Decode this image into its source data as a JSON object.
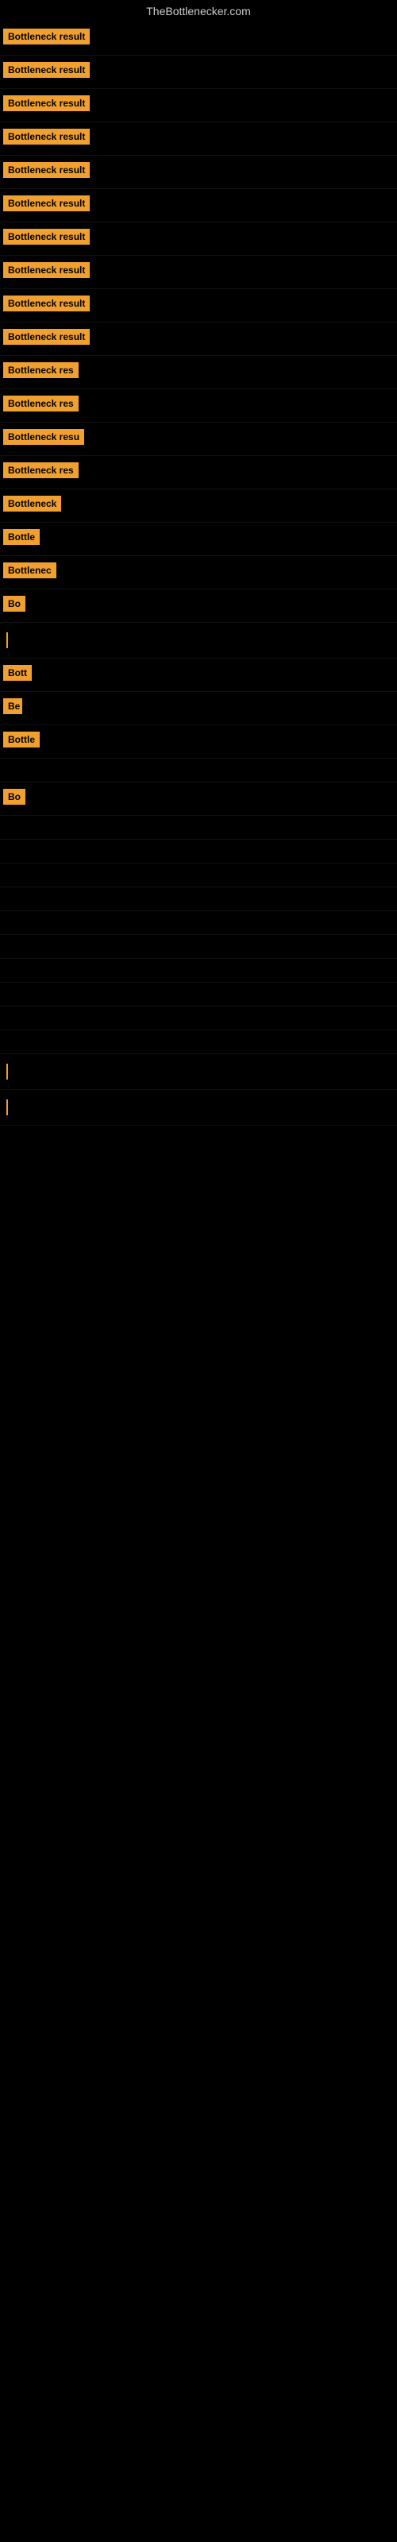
{
  "site": {
    "title": "TheBottlenecker.com"
  },
  "rows": [
    {
      "label": "Bottleneck result",
      "width": 148,
      "show": true
    },
    {
      "label": "Bottleneck result",
      "width": 155,
      "show": true
    },
    {
      "label": "Bottleneck result",
      "width": 154,
      "show": true
    },
    {
      "label": "Bottleneck result",
      "width": 151,
      "show": true
    },
    {
      "label": "Bottleneck result",
      "width": 148,
      "show": true
    },
    {
      "label": "Bottleneck result",
      "width": 146,
      "show": true
    },
    {
      "label": "Bottleneck result",
      "width": 140,
      "show": true
    },
    {
      "label": "Bottleneck result",
      "width": 138,
      "show": true
    },
    {
      "label": "Bottleneck result",
      "width": 135,
      "show": true
    },
    {
      "label": "Bottleneck result",
      "width": 133,
      "show": true
    },
    {
      "label": "Bottleneck res",
      "width": 120,
      "show": true
    },
    {
      "label": "Bottleneck res",
      "width": 115,
      "show": true
    },
    {
      "label": "Bottleneck resu",
      "width": 112,
      "show": true
    },
    {
      "label": "Bottleneck res",
      "width": 108,
      "show": true
    },
    {
      "label": "Bottleneck",
      "width": 90,
      "show": true
    },
    {
      "label": "Bottle",
      "width": 60,
      "show": true
    },
    {
      "label": "Bottlenec",
      "width": 80,
      "show": true
    },
    {
      "label": "Bo",
      "width": 28,
      "show": true
    },
    {
      "label": "|",
      "width": 10,
      "show": true,
      "line": true
    },
    {
      "label": "Bott",
      "width": 38,
      "show": true
    },
    {
      "label": "Be",
      "width": 24,
      "show": true
    },
    {
      "label": "Bottle",
      "width": 52,
      "show": true
    },
    {
      "label": "",
      "width": 0,
      "show": false
    },
    {
      "label": "Bo",
      "width": 28,
      "show": true
    },
    {
      "label": "",
      "width": 0,
      "show": false
    },
    {
      "label": "",
      "width": 0,
      "show": false
    },
    {
      "label": "",
      "width": 0,
      "show": false
    },
    {
      "label": "",
      "width": 0,
      "show": false
    },
    {
      "label": "",
      "width": 0,
      "show": false
    },
    {
      "label": "",
      "width": 0,
      "show": false
    },
    {
      "label": "",
      "width": 0,
      "show": false
    },
    {
      "label": "",
      "width": 0,
      "show": false
    },
    {
      "label": "",
      "width": 0,
      "show": false
    },
    {
      "label": "",
      "width": 0,
      "show": false
    },
    {
      "label": "|",
      "width": 10,
      "show": true,
      "line": true
    },
    {
      "label": "|",
      "width": 10,
      "show": true,
      "line": true
    }
  ]
}
